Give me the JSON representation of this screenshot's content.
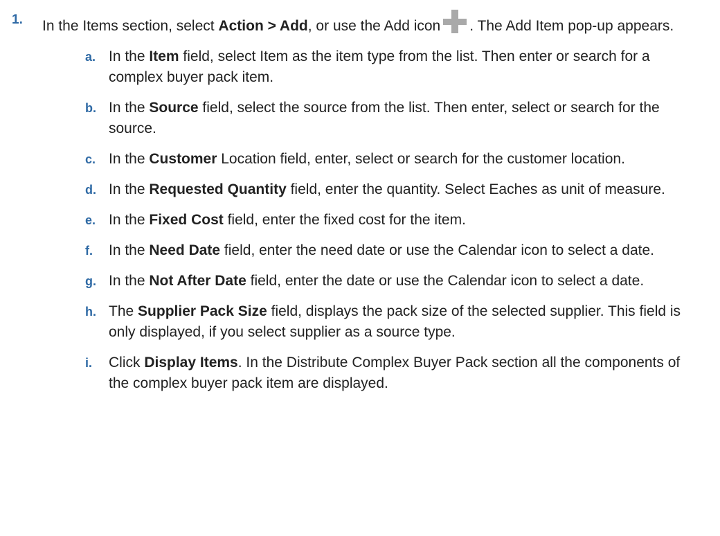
{
  "step1": {
    "number": "1.",
    "pre": "In the Items section, select ",
    "action_bold": "Action > Add",
    "mid": ", or use the Add icon",
    "post": ". The Add Item pop-up appears."
  },
  "substeps": [
    {
      "letter": "a.",
      "pre": "In the ",
      "bold": "Item",
      "post": " field, select Item as the item type from the list. Then enter or search for a complex buyer pack item."
    },
    {
      "letter": "b.",
      "pre": "In the ",
      "bold": "Source",
      "post": " field, select the source from the list. Then enter, select or search for the source."
    },
    {
      "letter": "c.",
      "pre": "In the ",
      "bold": "Customer",
      "post": " Location field, enter, select or search for the customer location."
    },
    {
      "letter": "d.",
      "pre": "In the ",
      "bold": "Requested Quantity",
      "post": " field, enter the quantity. Select Eaches as unit of measure."
    },
    {
      "letter": "e.",
      "pre": "In the ",
      "bold": "Fixed Cost",
      "post": " field, enter the fixed cost for the item."
    },
    {
      "letter": "f.",
      "pre": "In the ",
      "bold": "Need Date",
      "post": " field, enter the need date or use the Calendar icon to select a date."
    },
    {
      "letter": "g.",
      "pre": "In the ",
      "bold": "Not After Date",
      "post": " field, enter the date or use the Calendar icon to select a date."
    },
    {
      "letter": "h.",
      "pre": "The ",
      "bold": "Supplier Pack Size",
      "post": " field, displays the pack size of the selected supplier. This field is only displayed, if you select supplier as a source type."
    },
    {
      "letter": "i.",
      "pre": "Click ",
      "bold": "Display Items",
      "post": ". In the Distribute Complex Buyer Pack section all the components of the complex buyer pack item are displayed."
    }
  ],
  "icons": {
    "add": "plus-icon",
    "add_color": "#a9a9a9"
  },
  "colors": {
    "list_marker": "#2f6aa5",
    "text": "#222222"
  }
}
